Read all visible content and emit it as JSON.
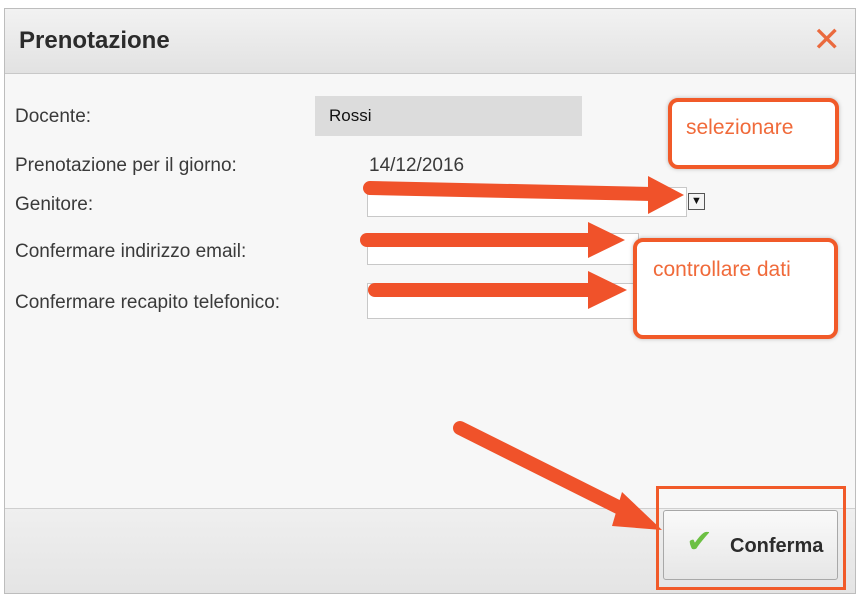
{
  "dialog": {
    "title": "Prenotazione",
    "close_icon": "close-icon"
  },
  "form": {
    "teacher_label": "Docente:",
    "teacher_value": "Rossi",
    "date_label": "Prenotazione per il giorno:",
    "date_value": "14/12/2016",
    "parent_label": "Genitore:",
    "email_label": "Confermare indirizzo email:",
    "phone_label": "Confermare recapito telefonico:"
  },
  "annotations": {
    "select_callout": "selezionare",
    "check_callout": "controllare dati"
  },
  "footer": {
    "confirm_label": "Conferma",
    "confirm_icon": "checkmark-icon"
  },
  "colors": {
    "annotation": "#f15a29",
    "confirm_check": "#6cc043",
    "close": "#ea6a3e"
  }
}
